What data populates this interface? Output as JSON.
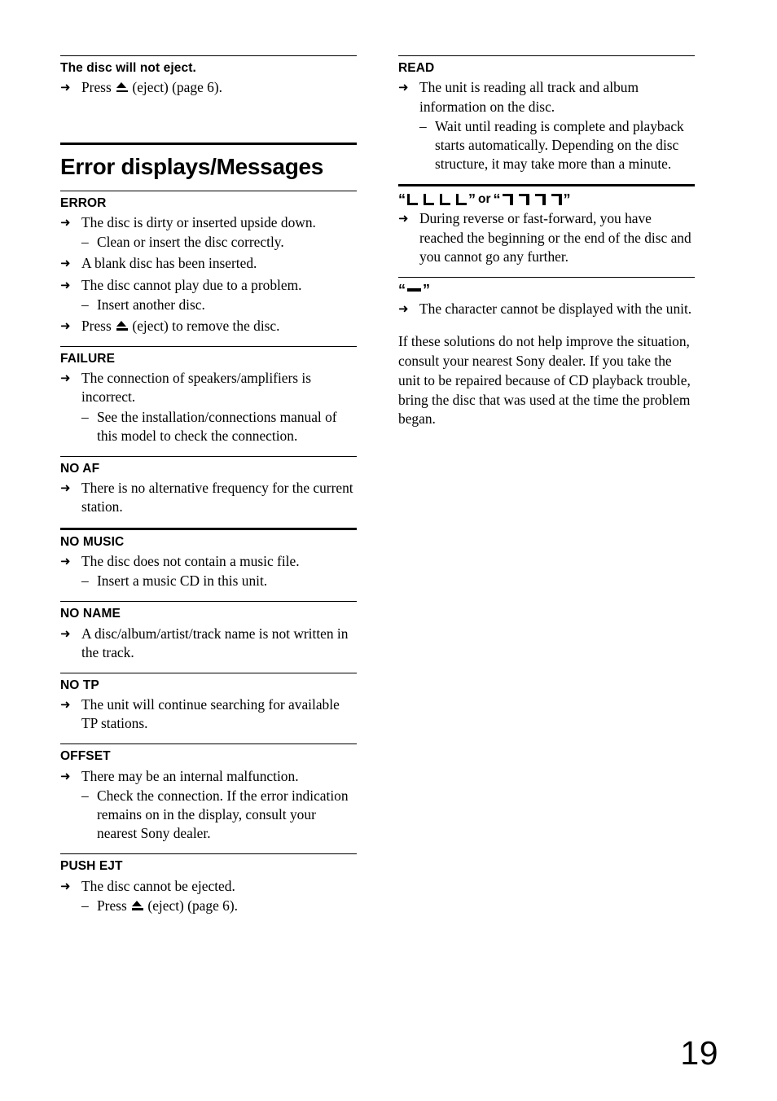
{
  "page": {
    "number": "19"
  },
  "glyphs": {
    "arrow": "➜",
    "dash": "–",
    "eject_name": "eject-symbol",
    "open_quote": "“",
    "close_quote": "”"
  },
  "left_column": {
    "sections": [
      {
        "rule": "thin",
        "heading": "The disc will not eject.",
        "heading_style": "bold-sans",
        "items": [
          {
            "type": "arrow",
            "parts": [
              "Press ",
              "EJECT_ICON",
              " (eject) (page 6)."
            ],
            "text": "Press ⏏ (eject) (page 6)."
          }
        ]
      },
      {
        "rule": "thick",
        "big_heading": "Error displays/Messages"
      },
      {
        "rule": "thin",
        "heading": "ERROR",
        "items": [
          {
            "type": "arrow",
            "text": "The disc is dirty or inserted upside down."
          },
          {
            "type": "dash",
            "text": "Clean or insert the disc correctly."
          },
          {
            "type": "arrow",
            "text": "A blank disc has been inserted."
          },
          {
            "type": "arrow",
            "text": "The disc cannot play due to a problem."
          },
          {
            "type": "dash",
            "text": "Insert another disc."
          },
          {
            "type": "arrow",
            "parts": [
              "Press ",
              "EJECT_ICON",
              " (eject) to remove the disc."
            ],
            "text": "Press ⏏ (eject) to remove the disc."
          }
        ]
      },
      {
        "rule": "thin",
        "heading": "FAILURE",
        "items": [
          {
            "type": "arrow",
            "text": "The connection of speakers/amplifiers is incorrect."
          },
          {
            "type": "dash",
            "text": "See the installation/connections manual of this model to check the connection."
          }
        ]
      },
      {
        "rule": "thin",
        "heading": "NO AF",
        "items": [
          {
            "type": "arrow",
            "text": "There is no alternative frequency for the current station."
          }
        ]
      },
      {
        "rule": "thick",
        "heading": "NO MUSIC",
        "items": [
          {
            "type": "arrow",
            "text": "The disc does not contain a music file."
          },
          {
            "type": "dash",
            "text": "Insert a music CD in this unit."
          }
        ]
      },
      {
        "rule": "thin",
        "heading": "NO NAME",
        "items": [
          {
            "type": "arrow",
            "text": "A disc/album/artist/track name is not written in the track."
          }
        ]
      },
      {
        "rule": "thin",
        "heading": "NO TP",
        "items": [
          {
            "type": "arrow",
            "text": "The unit will continue searching for available TP stations."
          }
        ]
      },
      {
        "rule": "thin",
        "heading": "OFFSET",
        "items": [
          {
            "type": "arrow",
            "text": "There may be an internal malfunction."
          },
          {
            "type": "dash",
            "text": "Check the connection. If the error indication remains on in the display, consult your nearest Sony dealer."
          }
        ]
      },
      {
        "rule": "thin",
        "heading": "PUSH EJT",
        "items": [
          {
            "type": "arrow",
            "text": "The disc cannot be ejected."
          },
          {
            "type": "dash",
            "parts": [
              "Press ",
              "EJECT_ICON",
              " (eject) (page 6)."
            ],
            "text": "Press ⏏ (eject) (page 6)."
          }
        ]
      }
    ]
  },
  "right_column": {
    "sections": [
      {
        "rule": "thin",
        "heading": "READ",
        "items": [
          {
            "type": "arrow",
            "text": "The unit is reading all track and album information on the disc."
          },
          {
            "type": "dash",
            "text": "Wait until reading is complete and playback starts automatically. Depending on the disc structure, it may take more than a minute."
          }
        ]
      },
      {
        "rule": "thick",
        "heading_type": "glyph-corners",
        "heading_text": "“⌞ ⌞ ⌞ ⌞” or “¬ ¬ ¬ ¬”",
        "conjunction": "or",
        "left_glyph_count": 4,
        "right_glyph_count": 4,
        "left_glyph_name": "bottom-left-corner-bracket",
        "right_glyph_name": "top-right-corner-bracket",
        "items": [
          {
            "type": "arrow",
            "text": "During reverse or fast-forward, you have reached the beginning or the end of the disc and you cannot go any further."
          }
        ]
      },
      {
        "rule": "thin",
        "heading_type": "glyph-bar",
        "heading_text": "“—”",
        "glyph_name": "underscore-bar",
        "items": [
          {
            "type": "arrow",
            "text": "The character cannot be displayed with the unit."
          }
        ]
      }
    ],
    "closing_paragraph": "If these solutions do not help improve the situation, consult your nearest Sony dealer. If you take the unit to be repaired because of CD playback trouble, bring the disc that was used at the time the problem began."
  }
}
